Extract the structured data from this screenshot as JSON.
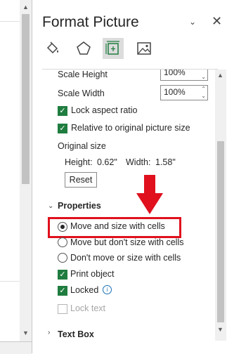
{
  "pane": {
    "title": "Format Picture",
    "dropdown_icon": "chevron-down-icon",
    "close_icon": "close-icon",
    "categories": [
      {
        "name": "fill-line",
        "icon": "paint-bucket-icon"
      },
      {
        "name": "effects",
        "icon": "pentagon-icon"
      },
      {
        "name": "size-properties",
        "icon": "size-properties-icon",
        "active": true
      },
      {
        "name": "picture",
        "icon": "picture-icon"
      }
    ]
  },
  "size": {
    "scale_height_label": "Scale Height",
    "scale_height_value": "100%",
    "scale_width_label": "Scale Width",
    "scale_width_value": "100%",
    "lock_aspect_label": "Lock aspect ratio",
    "lock_aspect_checked": true,
    "relative_label": "Relative to original picture size",
    "relative_checked": true,
    "original_size_label": "Original size",
    "height_label": "Height:",
    "height_value": "0.62\"",
    "width_label": "Width:",
    "width_value": "1.58\"",
    "reset_label": "Reset"
  },
  "properties": {
    "heading": "Properties",
    "options": [
      {
        "label": "Move and size with cells",
        "selected": true
      },
      {
        "label": "Move but don't size with cells",
        "selected": false
      },
      {
        "label": "Don't move or size with cells",
        "selected": false
      }
    ],
    "print_label": "Print object",
    "print_checked": true,
    "locked_label": "Locked",
    "locked_checked": true,
    "lock_text_label": "Lock text",
    "lock_text_checked": false
  },
  "textbox": {
    "heading": "Text Box"
  },
  "annotation": {
    "arrow_color": "#e0101d",
    "highlight_color": "#e0101d"
  }
}
